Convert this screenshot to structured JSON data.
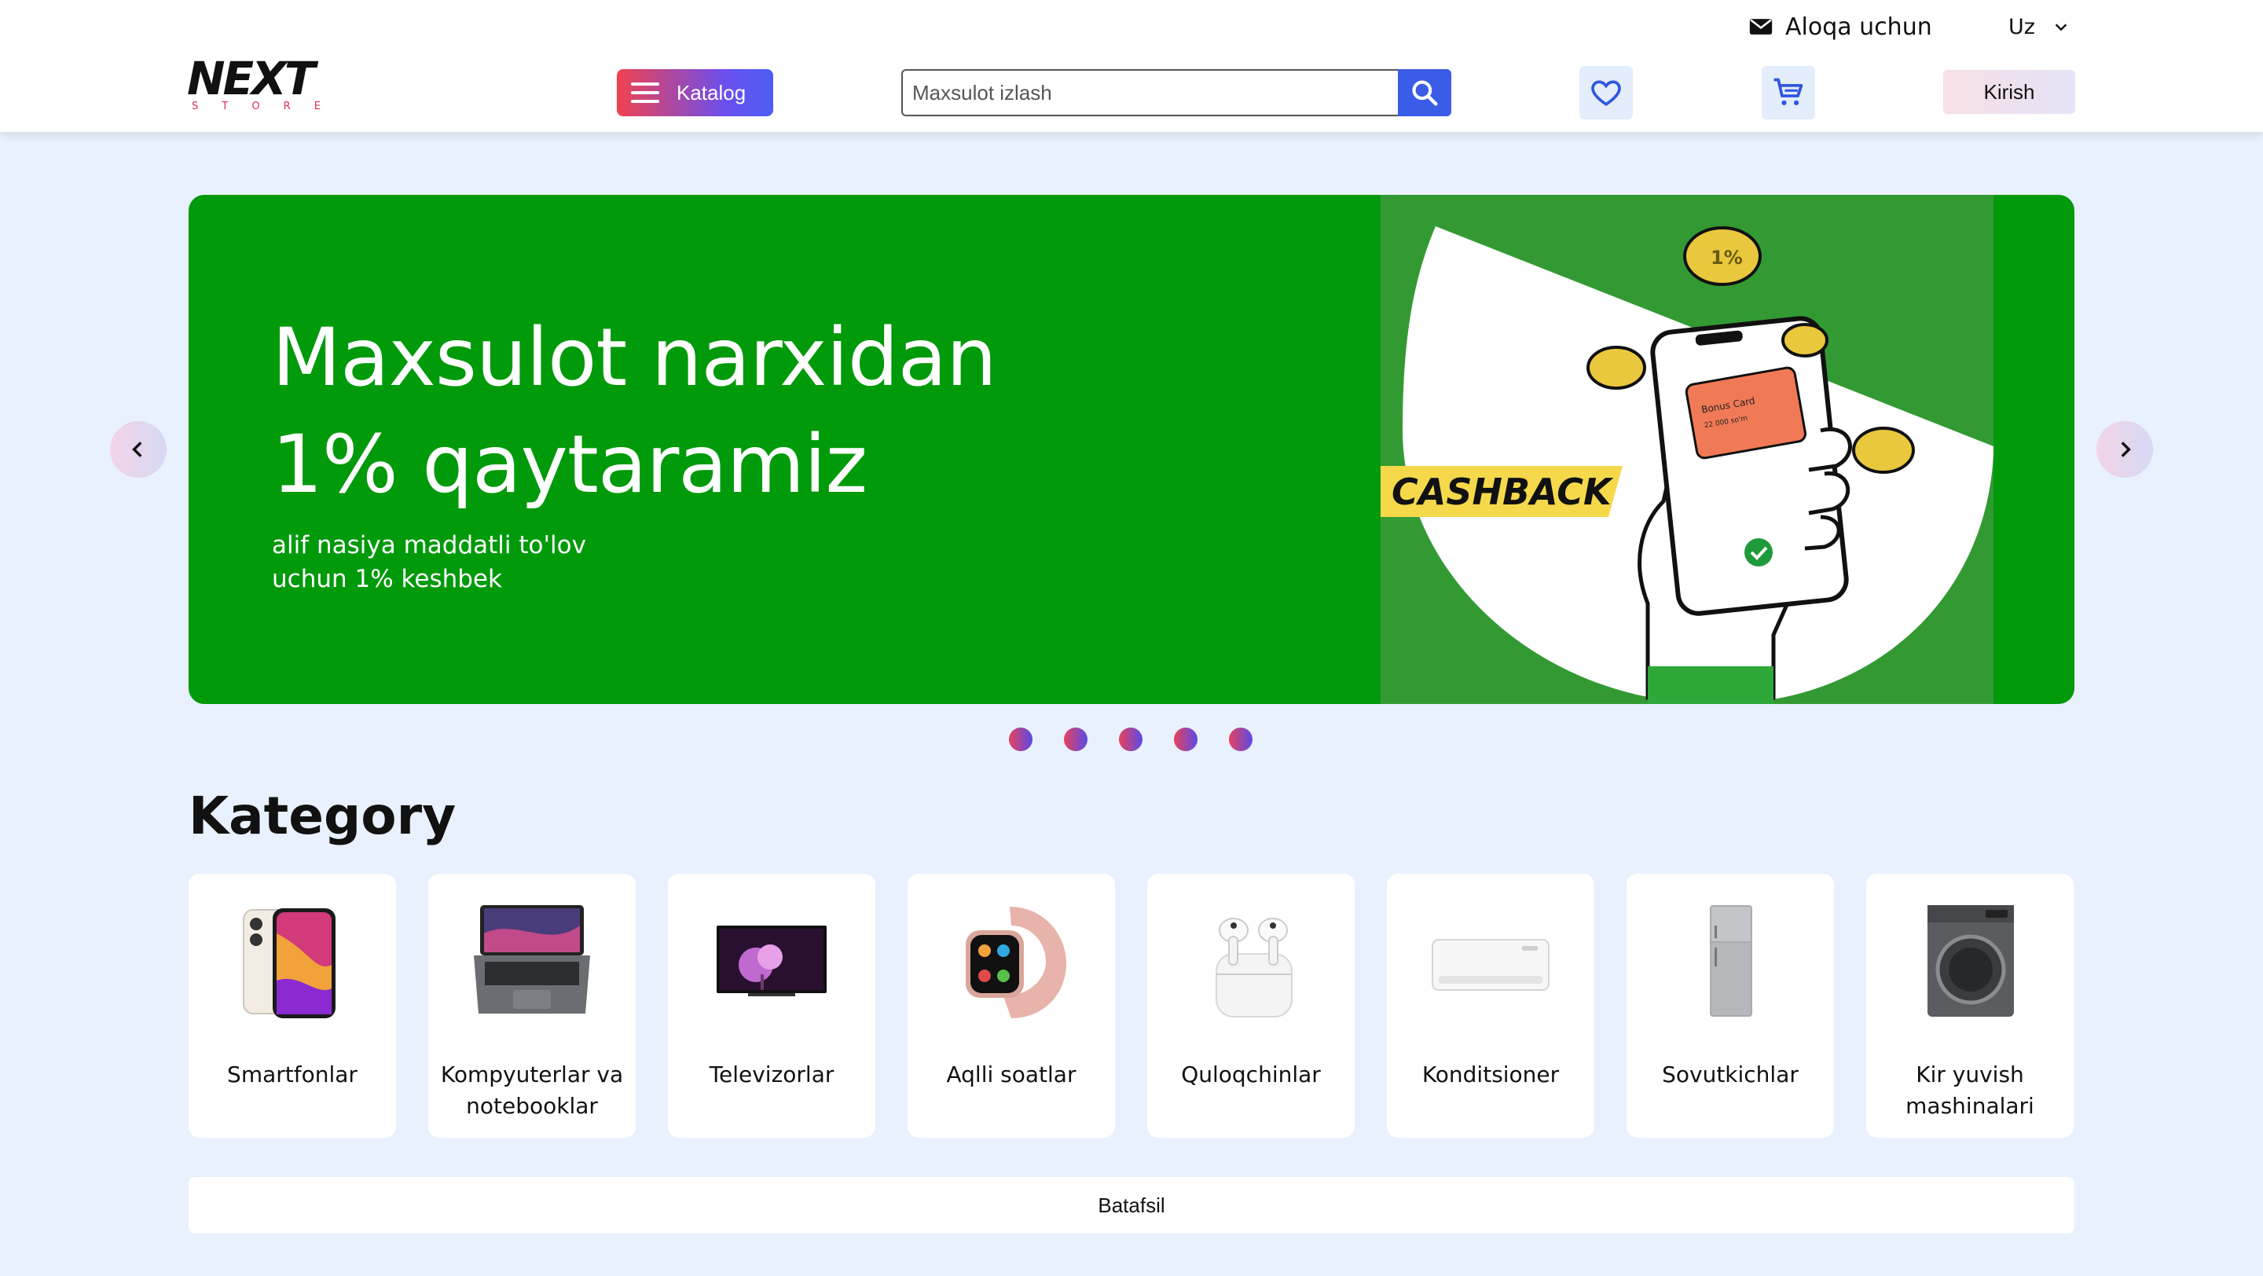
{
  "header": {
    "contact_label": "Aloqa uchun",
    "language": "Uz",
    "logo_main": "NEXT",
    "logo_sub": [
      "S",
      "T",
      "O",
      "R",
      "E"
    ],
    "catalog_label": "Katalog",
    "search_placeholder": "Maxsulot izlash",
    "login_label": "Kirish"
  },
  "banner": {
    "title_line1": "Maxsulot narxidan",
    "title_line2": "1% qaytaramiz",
    "subtitle_line1": "alif nasiya maddatli to'lov",
    "subtitle_line2": "uchun 1% keshbek",
    "art_badge": "CASHBACK",
    "card_label": "Bonus Card",
    "card_amount": "22 000 so'm",
    "coin_label": "1%",
    "slide_count": 5,
    "background_color": "#009a0a"
  },
  "categories": {
    "title": "Kategory",
    "items": [
      {
        "label": "Smartfonlar",
        "icon": "smartphone-image"
      },
      {
        "label": "Kompyuterlar va notebooklar",
        "icon": "laptop-image"
      },
      {
        "label": "Televizorlar",
        "icon": "tv-image"
      },
      {
        "label": "Aqlli soatlar",
        "icon": "smartwatch-image"
      },
      {
        "label": "Quloqchinlar",
        "icon": "earbuds-image"
      },
      {
        "label": "Konditsioner",
        "icon": "air-conditioner-image"
      },
      {
        "label": "Sovutkichlar",
        "icon": "fridge-image"
      },
      {
        "label": "Kir yuvish mashinalari",
        "icon": "washing-machine-image"
      }
    ],
    "more_label": "Batafsil"
  },
  "colors": {
    "page_bg": "#e8f1fd",
    "accent_blue": "#3b5ce6",
    "accent_red": "#f0424f",
    "banner_green": "#009a0a"
  }
}
